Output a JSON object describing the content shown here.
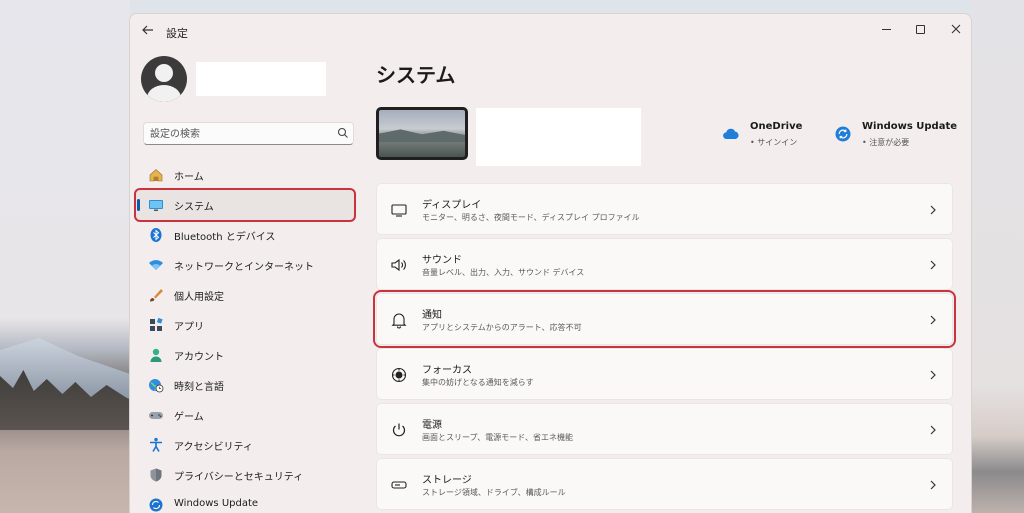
{
  "window": {
    "title": "設定"
  },
  "search": {
    "placeholder": "設定の検索"
  },
  "sidebar": {
    "items": [
      {
        "label": "ホーム",
        "icon": "home-icon"
      },
      {
        "label": "システム",
        "icon": "system-icon",
        "selected": true
      },
      {
        "label": "Bluetooth とデバイス",
        "icon": "bluetooth-icon"
      },
      {
        "label": "ネットワークとインターネット",
        "icon": "network-icon"
      },
      {
        "label": "個人用設定",
        "icon": "brush-icon"
      },
      {
        "label": "アプリ",
        "icon": "apps-icon"
      },
      {
        "label": "アカウント",
        "icon": "account-icon"
      },
      {
        "label": "時刻と言語",
        "icon": "globe-clock-icon"
      },
      {
        "label": "ゲーム",
        "icon": "gamepad-icon"
      },
      {
        "label": "アクセシビリティ",
        "icon": "accessibility-icon"
      },
      {
        "label": "プライバシーとセキュリティ",
        "icon": "shield-icon"
      },
      {
        "label": "Windows Update",
        "icon": "update-icon"
      }
    ]
  },
  "main": {
    "title": "システム",
    "quick_links": [
      {
        "title": "OneDrive",
        "subtitle": "• サインイン",
        "icon": "cloud-icon"
      },
      {
        "title": "Windows Update",
        "subtitle": "• 注意が必要",
        "icon": "sync-icon"
      }
    ],
    "cards": [
      {
        "title": "ディスプレイ",
        "subtitle": "モニター、明るさ、夜間モード、ディスプレイ プロファイル",
        "icon": "display-icon"
      },
      {
        "title": "サウンド",
        "subtitle": "音量レベル、出力、入力、サウンド デバイス",
        "icon": "speaker-icon"
      },
      {
        "title": "通知",
        "subtitle": "アプリとシステムからのアラート、応答不可",
        "icon": "bell-icon"
      },
      {
        "title": "フォーカス",
        "subtitle": "集中の妨げとなる通知を減らす",
        "icon": "focus-icon"
      },
      {
        "title": "電源",
        "subtitle": "画面とスリープ、電源モード、省エネ機能",
        "icon": "power-icon"
      },
      {
        "title": "ストレージ",
        "subtitle": "ストレージ領域、ドライブ、構成ルール",
        "icon": "storage-icon"
      }
    ]
  },
  "colors": {
    "accent": "#0a5ea8",
    "highlight_border": "#c7343f",
    "window_bg": "#f3eeed"
  }
}
